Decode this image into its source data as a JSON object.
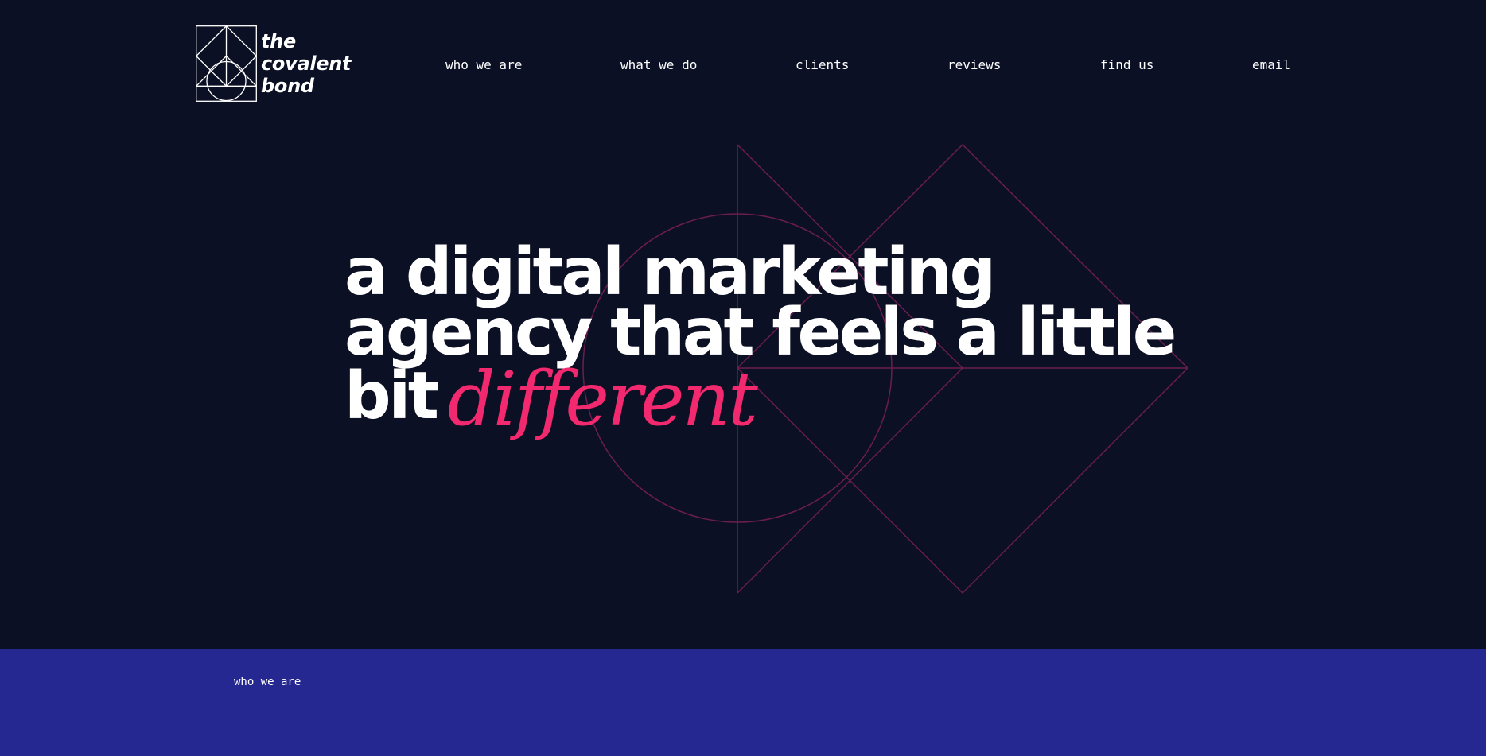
{
  "brand": {
    "lines": [
      "the",
      "covalent",
      "bond"
    ],
    "logo_icon": "geometric-logo-mark"
  },
  "nav": {
    "items": [
      {
        "label": "who we are"
      },
      {
        "label": "what we do"
      },
      {
        "label": "clients"
      },
      {
        "label": "reviews"
      },
      {
        "label": "find us"
      },
      {
        "label": "email"
      }
    ]
  },
  "hero": {
    "headline_line1": "a digital marketing",
    "headline_line2": "agency that feels a little",
    "headline_line3": "bit",
    "headline_accent": "different",
    "graphic_icon": "geometric-shapes-graphic"
  },
  "section": {
    "label": "who we are"
  },
  "colors": {
    "background": "#0c1024",
    "accent": "#f2296e",
    "section_background": "#262891",
    "text": "#ffffff"
  }
}
